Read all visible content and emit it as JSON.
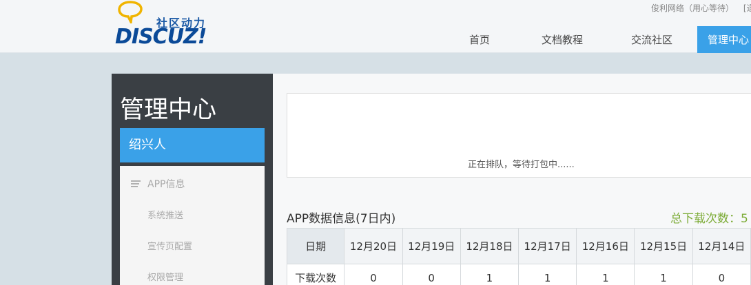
{
  "header": {
    "logo_tag": "社区动力",
    "logo_word": "DISCUZ!",
    "topbar": [
      "俊利网络（用心等待）",
      "[退"
    ],
    "nav": [
      {
        "label": "首页",
        "active": false
      },
      {
        "label": "文档教程",
        "active": false
      },
      {
        "label": "交流社区",
        "active": false
      },
      {
        "label": "管理中心",
        "active": true
      }
    ]
  },
  "sidebar": {
    "title": "管理中心",
    "user": "绍兴人",
    "menu_head": "APP信息",
    "menu_items": [
      "系统推送",
      "宣传页配置",
      "权限管理"
    ]
  },
  "main": {
    "queue_text": "正在排队，等待打包中......",
    "section_title": "APP数据信息(7日内)",
    "total_downloads": "总下载次数：5",
    "table": {
      "header": [
        "日期",
        "12月20日",
        "12月19日",
        "12月18日",
        "12月17日",
        "12月16日",
        "12月15日",
        "12月14日"
      ],
      "rows": [
        [
          "下载次数",
          "0",
          "0",
          "1",
          "1",
          "1",
          "1",
          "0"
        ]
      ]
    }
  },
  "colors": {
    "accent": "#3aa1e8",
    "sidebar_bg": "#3a3f44",
    "total_green": "#7cab36"
  }
}
